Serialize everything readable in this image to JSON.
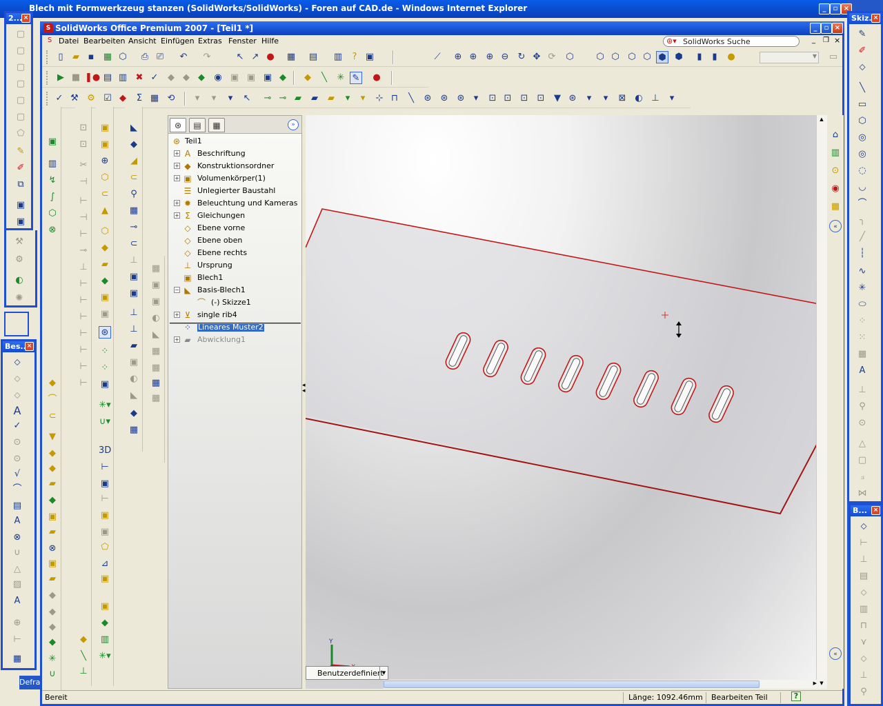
{
  "ie": {
    "title": "Blech mit Formwerkzeug stanzen (SolidWorks/SolidWorks) - Foren auf CAD.de - Windows Internet Explorer"
  },
  "sw": {
    "title": "SolidWorks Office Premium 2007 - [Teil1 *]",
    "menu": [
      "Datei",
      "Bearbeiten",
      "Ansicht",
      "Einfügen",
      "Extras",
      "Fenster",
      "Hilfe"
    ],
    "search_label": "SolidWorks Suche"
  },
  "floating_toolbars": {
    "top_left": "2...",
    "mid_left": "Bes...",
    "top_right": "Skiz...",
    "bottom_right": "B..."
  },
  "desktop_item": "Defra",
  "feature_tree": {
    "root": "Teil1",
    "items": [
      {
        "label": "Beschriftung",
        "expand": "+",
        "icon": "annotation-icon"
      },
      {
        "label": "Konstruktionsordner",
        "expand": "+",
        "icon": "folder-icon"
      },
      {
        "label": "Volumenkörper(1)",
        "expand": "+",
        "icon": "solid-body-icon"
      },
      {
        "label": "Unlegierter Baustahl",
        "expand": "",
        "icon": "material-icon"
      },
      {
        "label": "Beleuchtung und Kameras",
        "expand": "+",
        "icon": "lighting-icon"
      },
      {
        "label": "Gleichungen",
        "expand": "+",
        "icon": "equations-icon"
      },
      {
        "label": "Ebene vorne",
        "expand": "",
        "icon": "plane-icon"
      },
      {
        "label": "Ebene oben",
        "expand": "",
        "icon": "plane-icon"
      },
      {
        "label": "Ebene rechts",
        "expand": "",
        "icon": "plane-icon"
      },
      {
        "label": "Ursprung",
        "expand": "",
        "icon": "origin-icon"
      },
      {
        "label": "Blech1",
        "expand": "",
        "icon": "sheetmetal-icon"
      },
      {
        "label": "Basis-Blech1",
        "expand": "−",
        "icon": "base-flange-icon"
      },
      {
        "label": "(-) Skizze1",
        "expand": "",
        "icon": "sketch-icon"
      },
      {
        "label": "single rib4",
        "expand": "+",
        "icon": "forming-tool-icon"
      },
      {
        "label": "Lineares Muster2",
        "expand": "",
        "icon": "linear-pattern-icon"
      },
      {
        "label": "Abwicklung1",
        "expand": "+",
        "icon": "flatten-icon"
      }
    ]
  },
  "graphics": {
    "view_tab": "Benutzerdefiniert",
    "axis_x": "X",
    "axis_y": "Y"
  },
  "status": {
    "left": "Bereit",
    "length": "Länge: 1092.46mm",
    "mode": "Bearbeiten Teil",
    "help": "?"
  },
  "colors": {
    "edge_highlight": "#c01818",
    "selection": "#316ac5",
    "titlebar": "#1c4fd4"
  }
}
